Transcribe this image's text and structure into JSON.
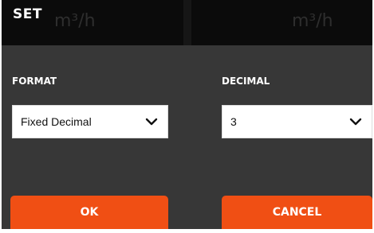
{
  "dialog": {
    "title": "SET",
    "background_unit_text": "m³/h"
  },
  "format": {
    "label": "FORMAT",
    "selected": "Fixed Decimal"
  },
  "decimal": {
    "label": "DECIMAL",
    "selected": "3"
  },
  "buttons": {
    "ok": "OK",
    "cancel": "CANCEL"
  },
  "colors": {
    "panel_bg": "#373737",
    "title_bg": "#0b0b0b",
    "accent": "#f04f14",
    "text": "#ffffff"
  },
  "icons": {
    "dropdown": "chevron-down-icon"
  }
}
